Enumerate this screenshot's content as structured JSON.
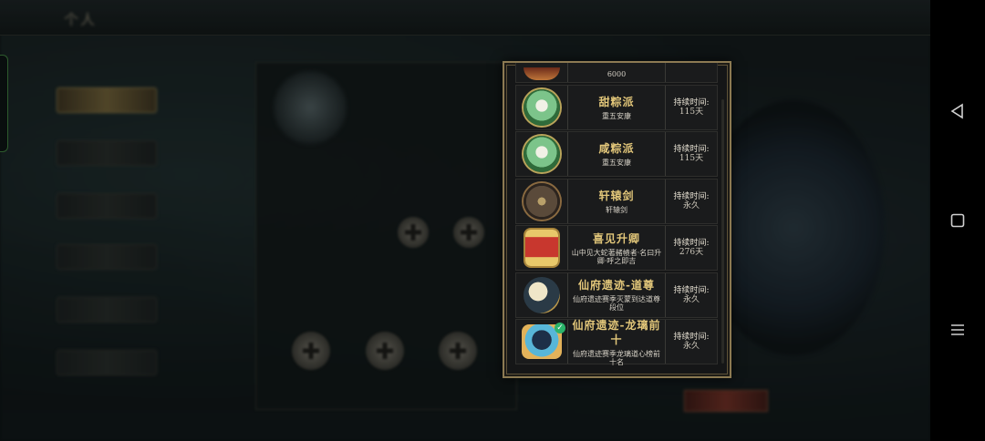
{
  "background": {
    "title": "个人"
  },
  "popup": {
    "partial_row": {
      "value": "6000"
    },
    "items": [
      {
        "name": "甜粽派",
        "desc": "重五安康",
        "dur_label": "持续时间:",
        "dur_value": "115天",
        "icon": "sweet-zongzi-badge-icon",
        "checked": false
      },
      {
        "name": "咸粽派",
        "desc": "重五安康",
        "dur_label": "持续时间:",
        "dur_value": "115天",
        "icon": "salty-zongzi-badge-icon",
        "checked": false
      },
      {
        "name": "轩辕剑",
        "desc": "轩辕剑",
        "dur_label": "持续时间:",
        "dur_value": "永久",
        "icon": "xuanyuan-sword-badge-icon",
        "checked": false
      },
      {
        "name": "喜见升卿",
        "desc": "山中见大蛇著赭帻者·名曰升卿·呼之即吉",
        "dur_label": "持续时间:",
        "dur_value": "276天",
        "icon": "red-scroll-badge-icon",
        "checked": false
      },
      {
        "name": "仙府遗迹-道尊",
        "desc": "仙府遗迹赛季灭蒙到达道尊段位",
        "dur_label": "持续时间:",
        "dur_value": "永久",
        "icon": "moon-badge-icon",
        "checked": false
      },
      {
        "name": "仙府遗迹-龙璃前十",
        "desc": "仙府遗迹赛季龙璃道心榜前十名",
        "dur_label": "持续时间:",
        "dur_value": "永久",
        "icon": "dragon-badge-icon",
        "checked": true
      }
    ]
  },
  "navbar": {
    "back_icon": "back-triangle-icon",
    "home_icon": "home-square-icon",
    "menu_icon": "menu-lines-icon"
  },
  "colors": {
    "gold_text": "#e3c77a",
    "frame": "#8c7a52",
    "check": "#2bb36a"
  }
}
